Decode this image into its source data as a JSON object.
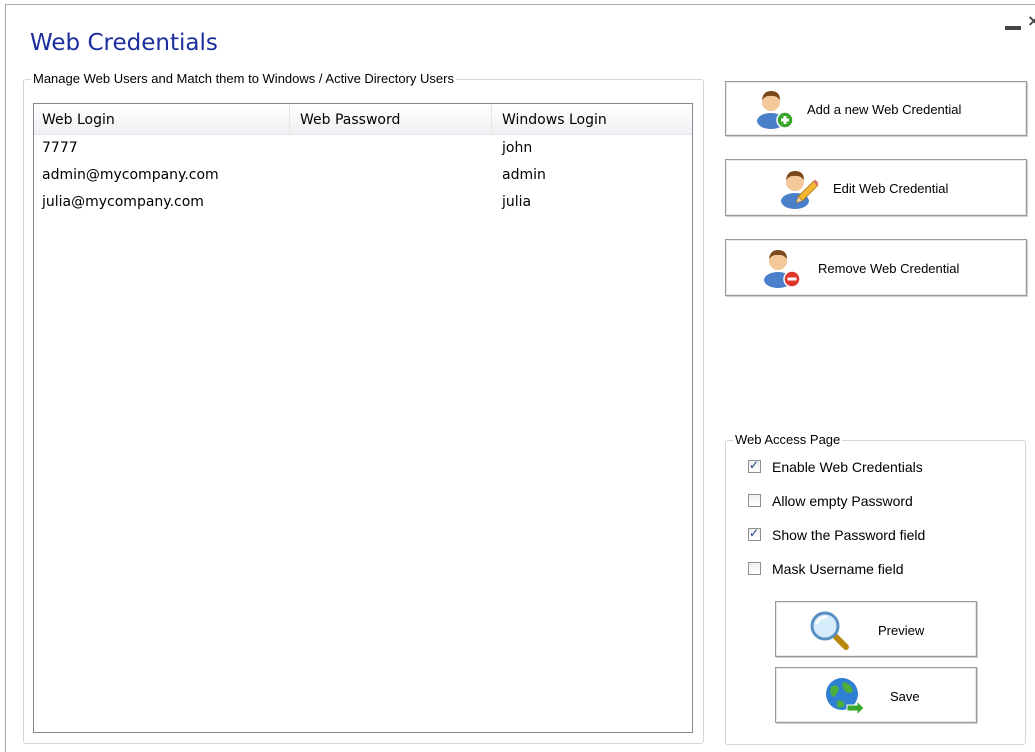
{
  "window": {
    "title": "Web Credentials",
    "minimize_icon": "minimize-icon",
    "close_icon": "close-icon"
  },
  "users_group": {
    "legend": "Manage Web Users and Match them to Windows / Active Directory Users",
    "columns": [
      "Web Login",
      "Web Password",
      "Windows Login"
    ],
    "rows": [
      {
        "web_login": "7777",
        "web_password": "",
        "windows_login": "john"
      },
      {
        "web_login": "admin@mycompany.com",
        "web_password": "",
        "windows_login": "admin"
      },
      {
        "web_login": "julia@mycompany.com",
        "web_password": "",
        "windows_login": "julia"
      }
    ]
  },
  "actions": {
    "add_label": "Add a new Web Credential",
    "edit_label": "Edit Web Credential",
    "remove_label": "Remove Web Credential"
  },
  "access_page": {
    "legend": "Web Access Page",
    "options": [
      {
        "label": "Enable Web Credentials",
        "checked": true
      },
      {
        "label": "Allow empty Password",
        "checked": false
      },
      {
        "label": "Show the Password field",
        "checked": true
      },
      {
        "label": "Mask Username field",
        "checked": false
      }
    ],
    "preview_label": "Preview",
    "save_label": "Save"
  },
  "colors": {
    "title": "#1c2e9e",
    "checkmark": "#1a3e8c",
    "add_badge": "#3aa52b",
    "remove_badge": "#e0352b",
    "user_hair": "#7a4a1c",
    "user_shirt": "#4a7fc9"
  }
}
